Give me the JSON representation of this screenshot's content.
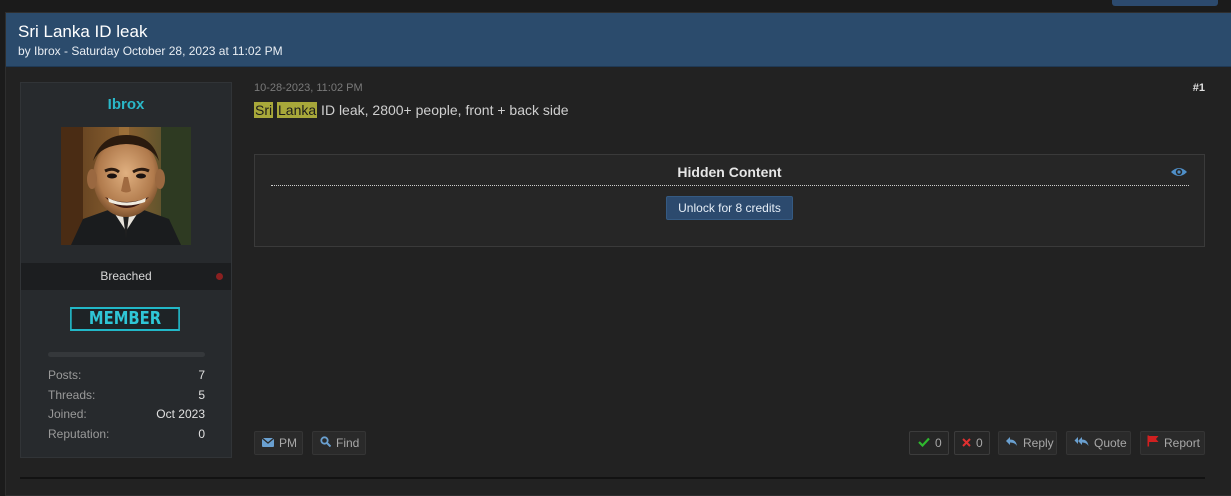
{
  "thread": {
    "title": "Sri Lanka ID leak",
    "byline": "by Ibrox - Saturday October 28, 2023 at 11:02 PM"
  },
  "user": {
    "username": "Ibrox",
    "avatar_alt": "avatar",
    "status": "Breached",
    "rank": "MEMBER",
    "stats": [
      {
        "label": "Posts:",
        "value": "7"
      },
      {
        "label": "Threads:",
        "value": "5"
      },
      {
        "label": "Joined:",
        "value": "Oct 2023"
      },
      {
        "label": "Reputation:",
        "value": "0"
      }
    ]
  },
  "post": {
    "date": "10-28-2023, 11:02 PM",
    "number": "#1",
    "highlight_1": "Sri",
    "highlight_2": "Lanka",
    "body_rest": " ID leak, 2800+ people, front + back side",
    "hidden": {
      "title": "Hidden Content",
      "unlock_label": "Unlock for 8 credits"
    }
  },
  "actions": {
    "pm": "PM",
    "find": "Find",
    "upvotes": "0",
    "downvotes": "0",
    "reply": "Reply",
    "quote": "Quote",
    "report": "Report"
  },
  "colors": {
    "header_bg": "#2b4b6c",
    "username": "#2ab8c8",
    "rank": "#2fc6d6",
    "highlight": "#a8a83a",
    "upvote": "#2eb82e",
    "downvote": "#e03030",
    "report": "#d02020",
    "status_offline": "#8a2020"
  },
  "icons": {
    "pm": "envelope-icon",
    "find": "search-icon",
    "upvote": "check-icon",
    "downvote": "x-icon",
    "reply": "reply-icon",
    "quote": "quote-icon",
    "report": "flag-icon",
    "hidden": "eye-icon"
  }
}
